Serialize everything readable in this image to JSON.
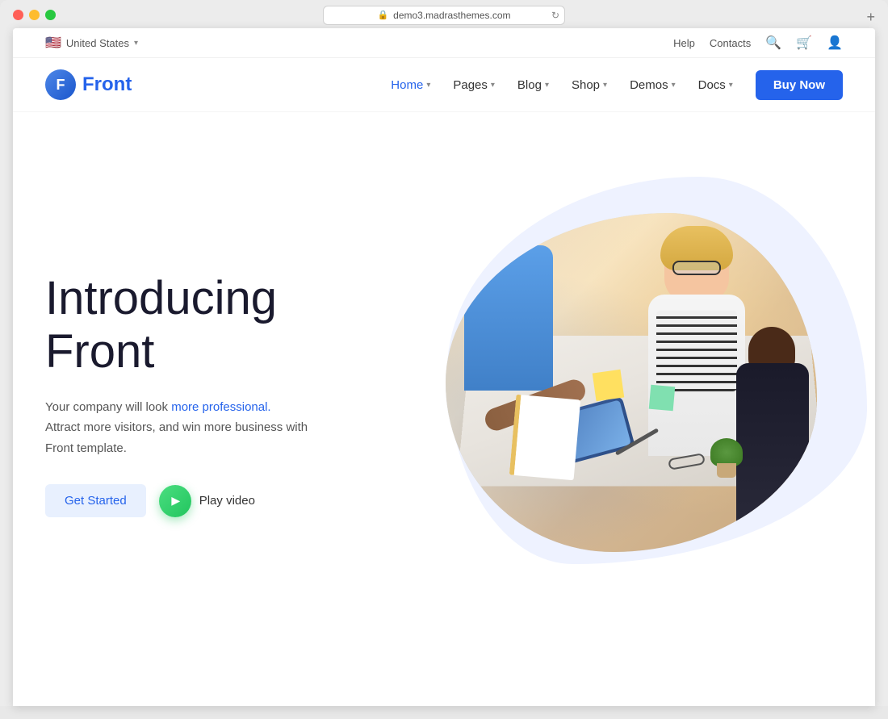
{
  "browser": {
    "url": "demo3.madrasthemes.com",
    "dots": [
      "red",
      "yellow",
      "green"
    ]
  },
  "utility_bar": {
    "region": "United States",
    "flag": "🇺🇸",
    "help_label": "Help",
    "contacts_label": "Contacts"
  },
  "navbar": {
    "logo_letter": "F",
    "logo_name": "Front",
    "nav_items": [
      {
        "label": "Home",
        "has_dropdown": true,
        "active": true
      },
      {
        "label": "Pages",
        "has_dropdown": true,
        "active": false
      },
      {
        "label": "Blog",
        "has_dropdown": true,
        "active": false
      },
      {
        "label": "Shop",
        "has_dropdown": true,
        "active": false
      },
      {
        "label": "Demos",
        "has_dropdown": true,
        "active": false
      },
      {
        "label": "Docs",
        "has_dropdown": true,
        "active": false
      }
    ],
    "buy_now_label": "Buy Now"
  },
  "hero": {
    "title_line1": "Introducing",
    "title_line2": "Front",
    "desc_normal1": "Your company will look ",
    "desc_highlight": "more professional.",
    "desc_normal2": "| Attract more visitors, and win more business with Front template.",
    "get_started_label": "Get Started",
    "play_video_label": "Play video"
  },
  "colors": {
    "primary": "#2563eb",
    "primary_light": "#e8f0fe",
    "green_play": "#22c55e",
    "text_dark": "#1a1a2e",
    "text_gray": "#555555"
  }
}
